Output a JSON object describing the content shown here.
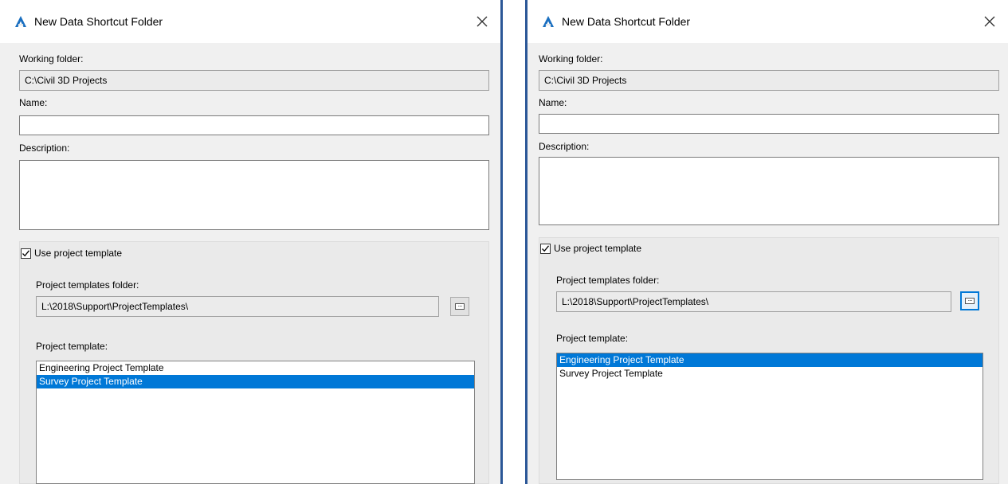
{
  "dialogs": [
    {
      "title": "New Data Shortcut Folder",
      "working_folder_label": "Working folder:",
      "working_folder_value": "C:\\Civil 3D Projects",
      "name_label": "Name:",
      "name_value": "",
      "description_label": "Description:",
      "description_value": "",
      "use_template_label": "Use project template",
      "use_template_checked": true,
      "templates_folder_label": "Project templates folder:",
      "templates_folder_value": "L:\\2018\\Support\\ProjectTemplates\\",
      "browse_icon": "ellipsis-icon",
      "project_template_label": "Project template:",
      "templates": [
        "Engineering Project Template",
        "Survey Project Template"
      ],
      "selected_template": "Survey Project Template"
    },
    {
      "title": "New Data Shortcut Folder",
      "working_folder_label": "Working folder:",
      "working_folder_value": "C:\\Civil 3D Projects",
      "name_label": "Name:",
      "name_value": "",
      "description_label": "Description:",
      "description_value": "",
      "use_template_label": "Use project template",
      "use_template_checked": true,
      "templates_folder_label": "Project templates folder:",
      "templates_folder_value": "L:\\2018\\Support\\ProjectTemplates\\",
      "browse_icon": "ellipsis-icon",
      "project_template_label": "Project template:",
      "templates": [
        "Engineering Project Template",
        "Survey Project Template"
      ],
      "selected_template": "Engineering Project Template"
    }
  ],
  "colors": {
    "selection": "#0078d7",
    "window_border": "#2b5797",
    "dialog_bg": "#f0f0f0",
    "app_icon": "#1a6fc0"
  }
}
